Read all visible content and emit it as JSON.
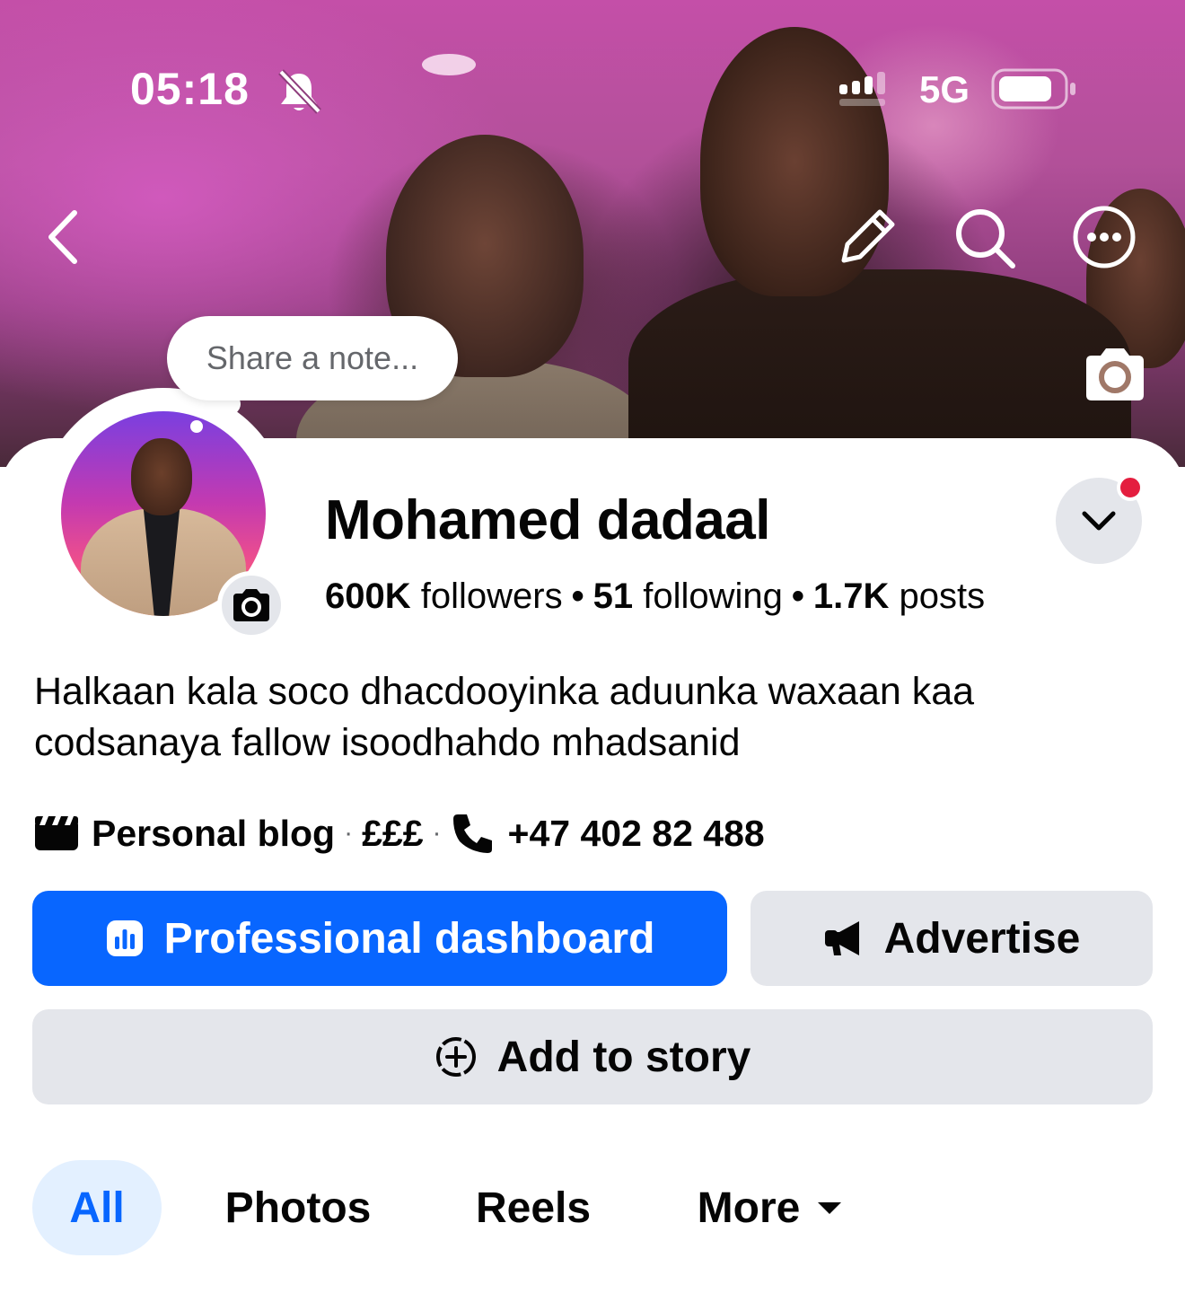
{
  "status_bar": {
    "time": "05:18",
    "network": "5G",
    "icons": [
      "bell-muted-icon",
      "signal-icon",
      "battery-icon"
    ]
  },
  "cover": {
    "icons": [
      "chevron-left-icon",
      "pencil-icon",
      "search-icon",
      "more-horizontal-icon",
      "camera-icon"
    ]
  },
  "note": {
    "placeholder": "Share a note..."
  },
  "profile": {
    "name": "Mohamed dadaal",
    "followers_count": "600K",
    "followers_label": "followers",
    "following_count": "51",
    "following_label": "following",
    "posts_count": "1.7K",
    "posts_label": "posts",
    "separator": "•",
    "bio": "Halkaan kala soco dhacdooyinka aduunka waxaan kaa codsanaya fallow isoodhahdo mhadsanid",
    "category": "Personal blog",
    "price_range": "£££",
    "phone": "+47 402 82 488",
    "detail_separator": "·"
  },
  "actions": {
    "dashboard_label": "Professional dashboard",
    "advertise_label": "Advertise",
    "story_label": "Add to story"
  },
  "tabs": [
    {
      "label": "All",
      "active": true
    },
    {
      "label": "Photos",
      "active": false
    },
    {
      "label": "Reels",
      "active": false
    },
    {
      "label": "More",
      "active": false
    }
  ],
  "colors": {
    "primary": "#0866ff",
    "secondary_button": "#e4e6eb",
    "active_tab_bg": "#e3f0ff",
    "notification": "#e41e3f"
  }
}
